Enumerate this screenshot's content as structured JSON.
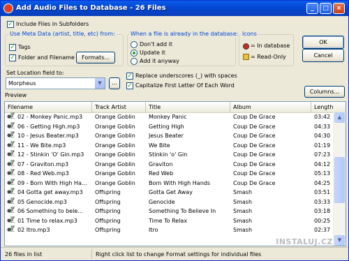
{
  "window": {
    "title": "Add Audio Files to Database - 26 Files"
  },
  "options": {
    "include_subfolders": "Include Files in Subfolders",
    "meta_group_title": "Use Meta Data (artist, title, etc) from:",
    "tags": "Tags",
    "folder_filename": "Folder and Filename",
    "formats_button": "Formats...",
    "already_group_title": "When a file is already in the database:",
    "dont_add": "Don't add it",
    "update": "Update it",
    "add_anyway": "Add it anyway",
    "icons_group_title": "Icons",
    "in_database": "= In database",
    "read_only": "= Read-Only",
    "location_label": "Set Location field to:",
    "location_value": "Morpheus",
    "browse_button": "...",
    "replace_underscores": "Replace underscores (_) with spaces",
    "capitalize": "Capitalize First Letter Of Each Word"
  },
  "buttons": {
    "ok": "OK",
    "cancel": "Cancel",
    "columns": "Columns..."
  },
  "preview": {
    "label": "Preview",
    "columns": [
      "Filename",
      "Track Artist",
      "Title",
      "Album",
      "Length"
    ],
    "rows": [
      [
        "02 - Monkey Panic.mp3",
        "Orange Goblin",
        "Monkey Panic",
        "Coup De Grace",
        "03:42"
      ],
      [
        "06 - Getting High.mp3",
        "Orange Goblin",
        "Getting High",
        "Coup De Grace",
        "04:33"
      ],
      [
        "10 - Jesus Beater.mp3",
        "Orange Goblin",
        "Jesus Beater",
        "Coup De Grace",
        "04:30"
      ],
      [
        "11 - We Bite.mp3",
        "Orange Goblin",
        "We Bite",
        "Coup De Grace",
        "01:19"
      ],
      [
        "12 - Stinkin 'O' Gin.mp3",
        "Orange Goblin",
        "Stinkin 'o' Gin",
        "Coup De Grace",
        "07:23"
      ],
      [
        "07 - Graviton.mp3",
        "Orange Goblin",
        "Graviton",
        "Coup De Grace",
        "04:12"
      ],
      [
        "08 - Red Web.mp3",
        "Orange Goblin",
        "Red Web",
        "Coup De Grace",
        "05:13"
      ],
      [
        "09 - Born With High Ha...",
        "Orange Goblin",
        "Born With High Hands",
        "Coup De Grace",
        "04:25"
      ],
      [
        "04 Gotta get away.mp3",
        "Offspring",
        "Gotta Get Away",
        "Smash",
        "03:51"
      ],
      [
        "05 Genocide.mp3",
        "Offspring",
        "Genocide",
        "Smash",
        "03:33"
      ],
      [
        "06 Something to bele...",
        "Offspring",
        "Something To Believe In",
        "Smash",
        "03:18"
      ],
      [
        "01 Time to relax.mp3",
        "Offspring",
        "Time To Relax",
        "Smash",
        "00:25"
      ],
      [
        "02 Itro.mp3",
        "Offspring",
        "Itro",
        "Smash",
        "02:37"
      ]
    ]
  },
  "status": {
    "count": "26 files in list",
    "hint": "Right click list to change Format settings for individual files"
  },
  "watermark": "INSTALUJ.CZ",
  "colors": {
    "title_bar": "#0348d6",
    "group_title": "#0046d5",
    "check": "#21a121"
  }
}
